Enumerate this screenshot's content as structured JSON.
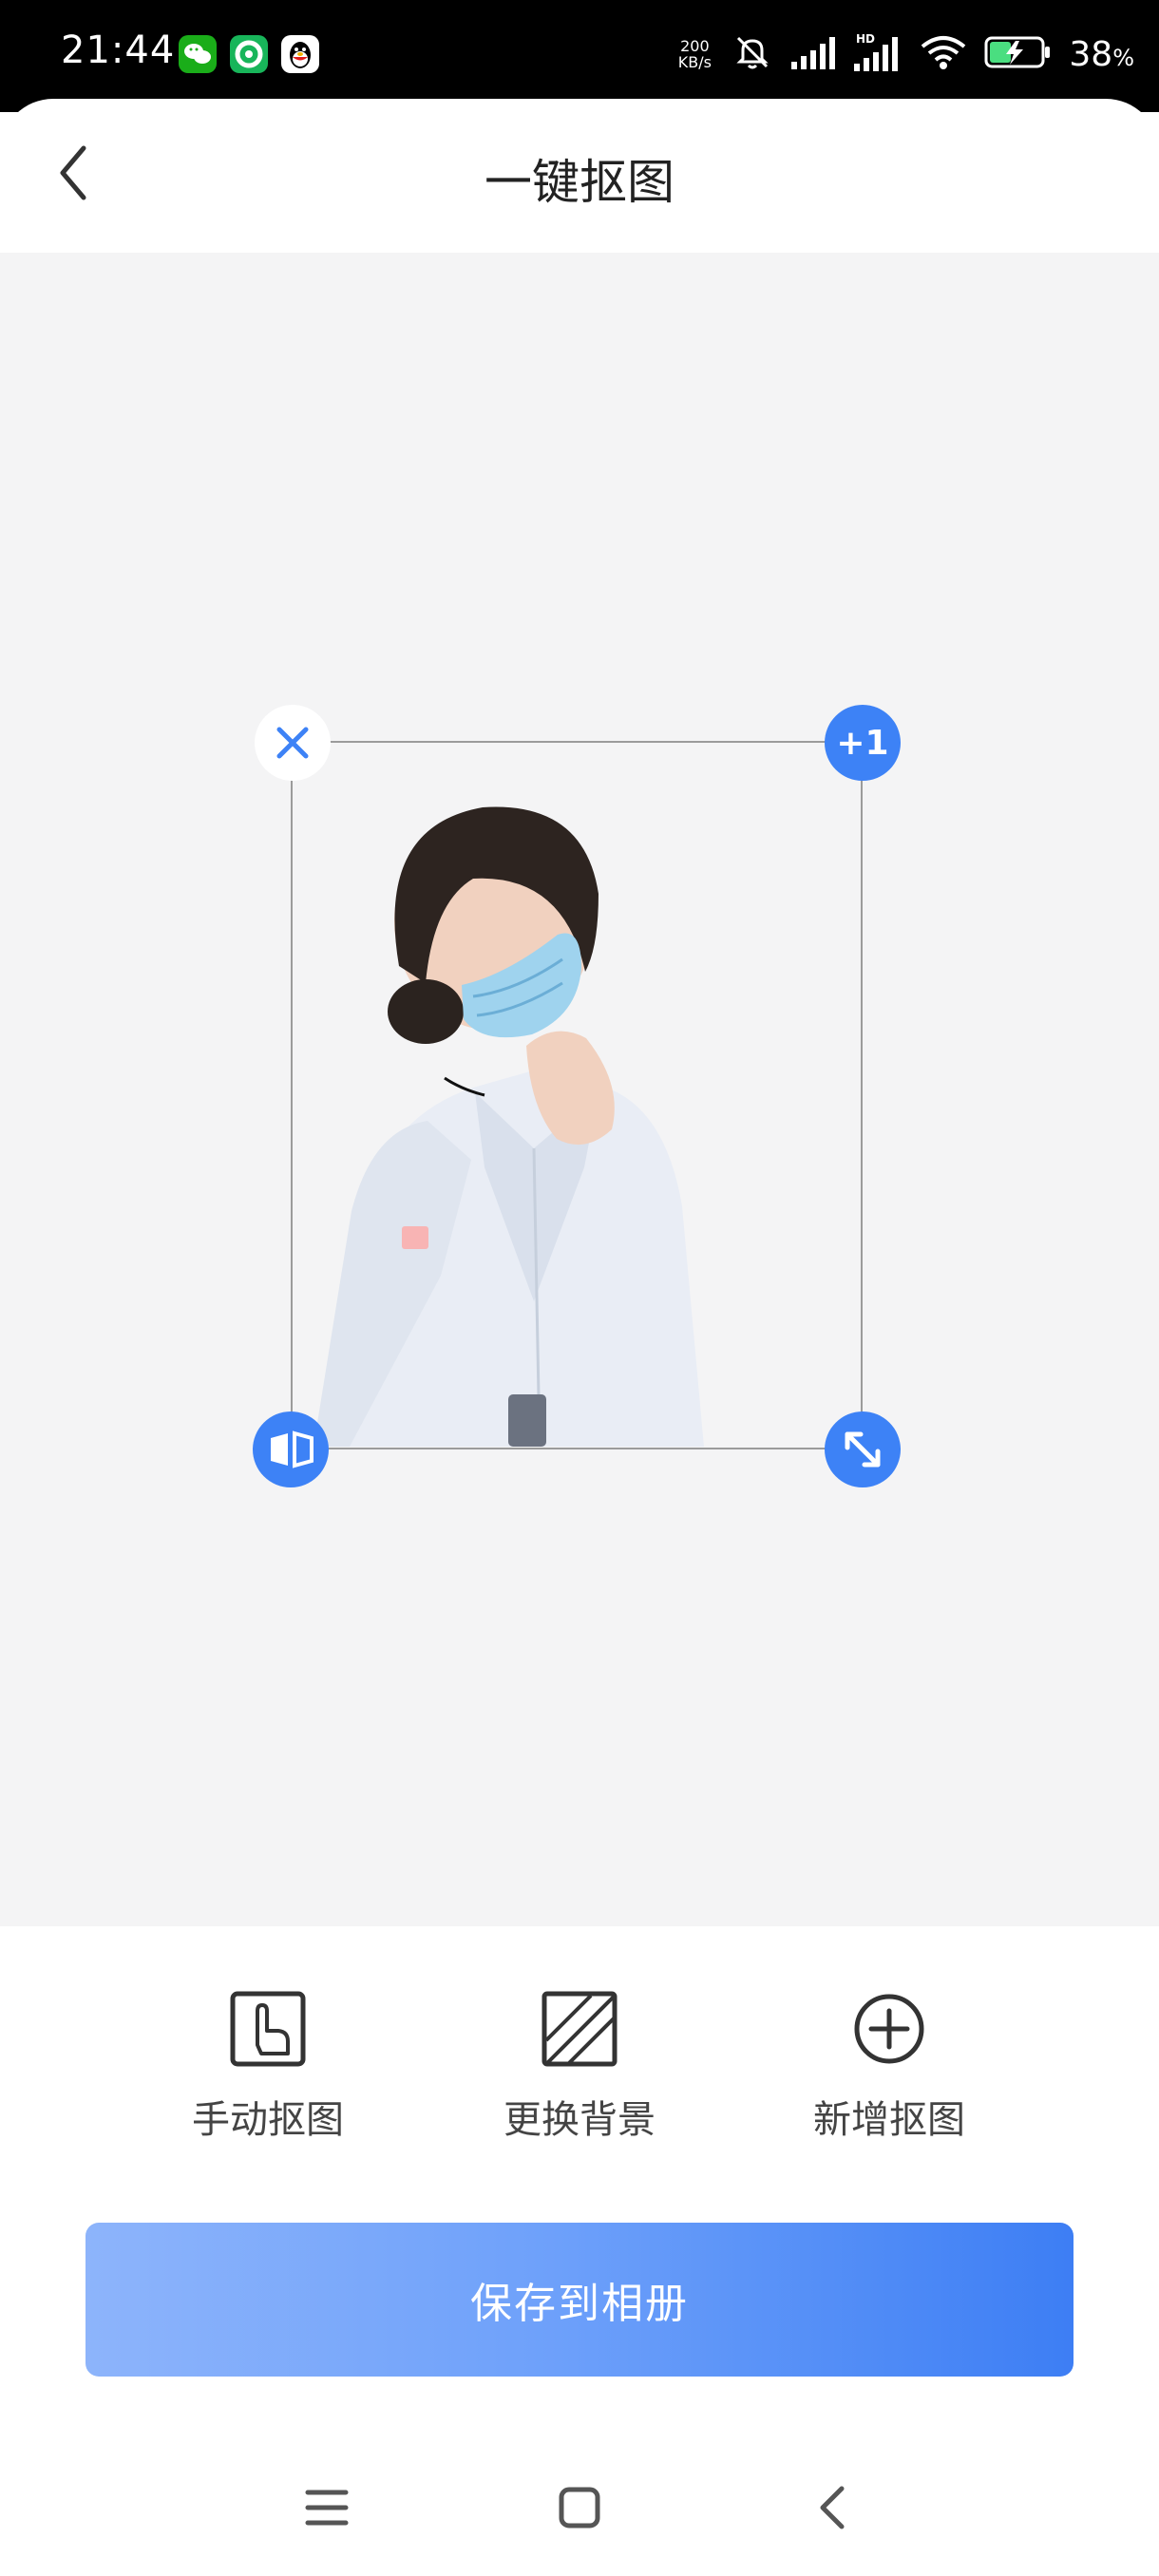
{
  "status_bar": {
    "time": "21:44",
    "net_speed_value": "200",
    "net_speed_unit": "KB/s",
    "battery_percent": "38",
    "battery_unit": "%",
    "app_icons": [
      "wechat-icon",
      "green-app-icon",
      "qq-icon"
    ],
    "system_icons": [
      "mute-bell-icon",
      "signal-icon",
      "hd-signal-icon",
      "wifi-icon",
      "battery-charging-icon"
    ]
  },
  "header": {
    "back_icon": "chevron-left-icon",
    "title": "一键抠图"
  },
  "canvas": {
    "controls": {
      "delete_icon": "close-icon",
      "plus_label": "+1",
      "flip_icon": "flip-icon",
      "scale_icon": "resize-icon"
    }
  },
  "tools": [
    {
      "label": "手动抠图",
      "icon": "hand-pointer-icon"
    },
    {
      "label": "更换背景",
      "icon": "diagonal-stripes-icon"
    },
    {
      "label": "新增抠图",
      "icon": "plus-circle-icon"
    }
  ],
  "save_button": {
    "label": "保存到相册"
  },
  "navigation": {
    "items": [
      "menu-icon",
      "home-icon",
      "back-icon"
    ]
  },
  "colors": {
    "accent": "#3d82f6",
    "canvas_background": "#f4f4f5",
    "status_bar": "#000000"
  }
}
